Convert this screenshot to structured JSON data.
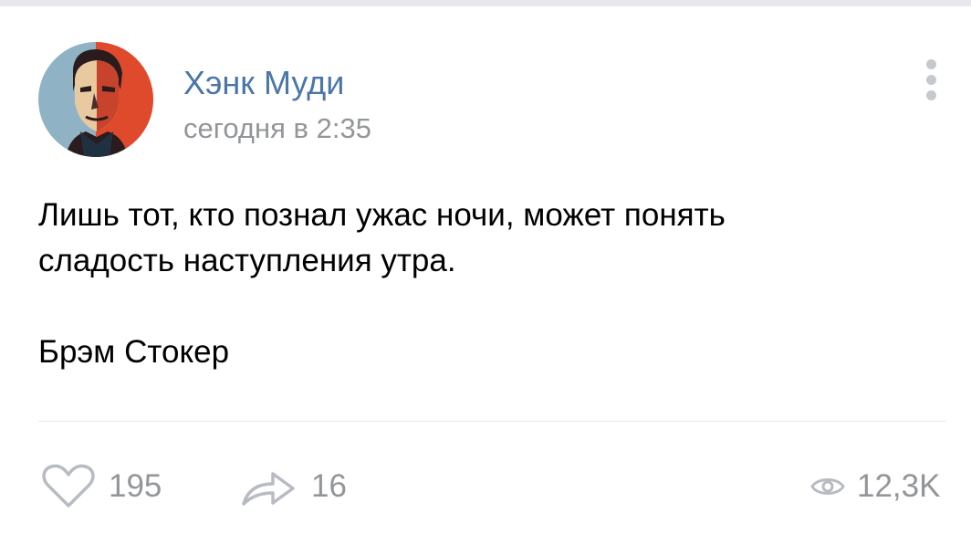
{
  "post": {
    "author": {
      "name": "Хэнк Муди",
      "avatar": "avatar-icon"
    },
    "time": "сегодня в 2:35",
    "menu_icon": "more-vertical-icon",
    "text": {
      "line1": "Лишь тот, кто познал ужас ночи, может понять",
      "line2": "сладость наступления утра.",
      "signature": "Брэм Стокер"
    },
    "actions": {
      "likes": {
        "icon": "heart-icon",
        "count": "195"
      },
      "shares": {
        "icon": "share-icon",
        "count": "16"
      },
      "views": {
        "icon": "eye-icon",
        "count": "12,3K"
      }
    }
  },
  "colors": {
    "author_link": "#4a76a8",
    "secondary_text": "#939699",
    "icon_gray": "#b8bcc2",
    "divider": "#e7e8ec"
  }
}
